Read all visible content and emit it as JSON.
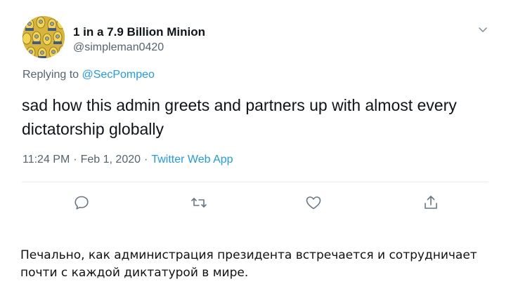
{
  "tweet": {
    "author_name": "1 in a 7.9 Billion Minion",
    "author_handle": "@simpleman0420",
    "replying_prefix": "Replying to",
    "replying_to": "@SecPompeo",
    "text": "sad how this admin greets and partners up with almost every dictatorship globally",
    "time": "11:24 PM",
    "date": "Feb 1, 2020",
    "separator": "·",
    "source": "Twitter Web App",
    "actions": [
      "reply-icon",
      "retweet-icon",
      "like-icon",
      "share-icon"
    ],
    "colors": {
      "link": "#1d9bf0",
      "secondary_text": "#536471",
      "primary_text": "#0f1419",
      "divider": "#e6ecf0"
    }
  },
  "translation": {
    "text": "Печально, как администрация президента встречается и сотрудничает почти с каждой диктатурой в мире."
  }
}
